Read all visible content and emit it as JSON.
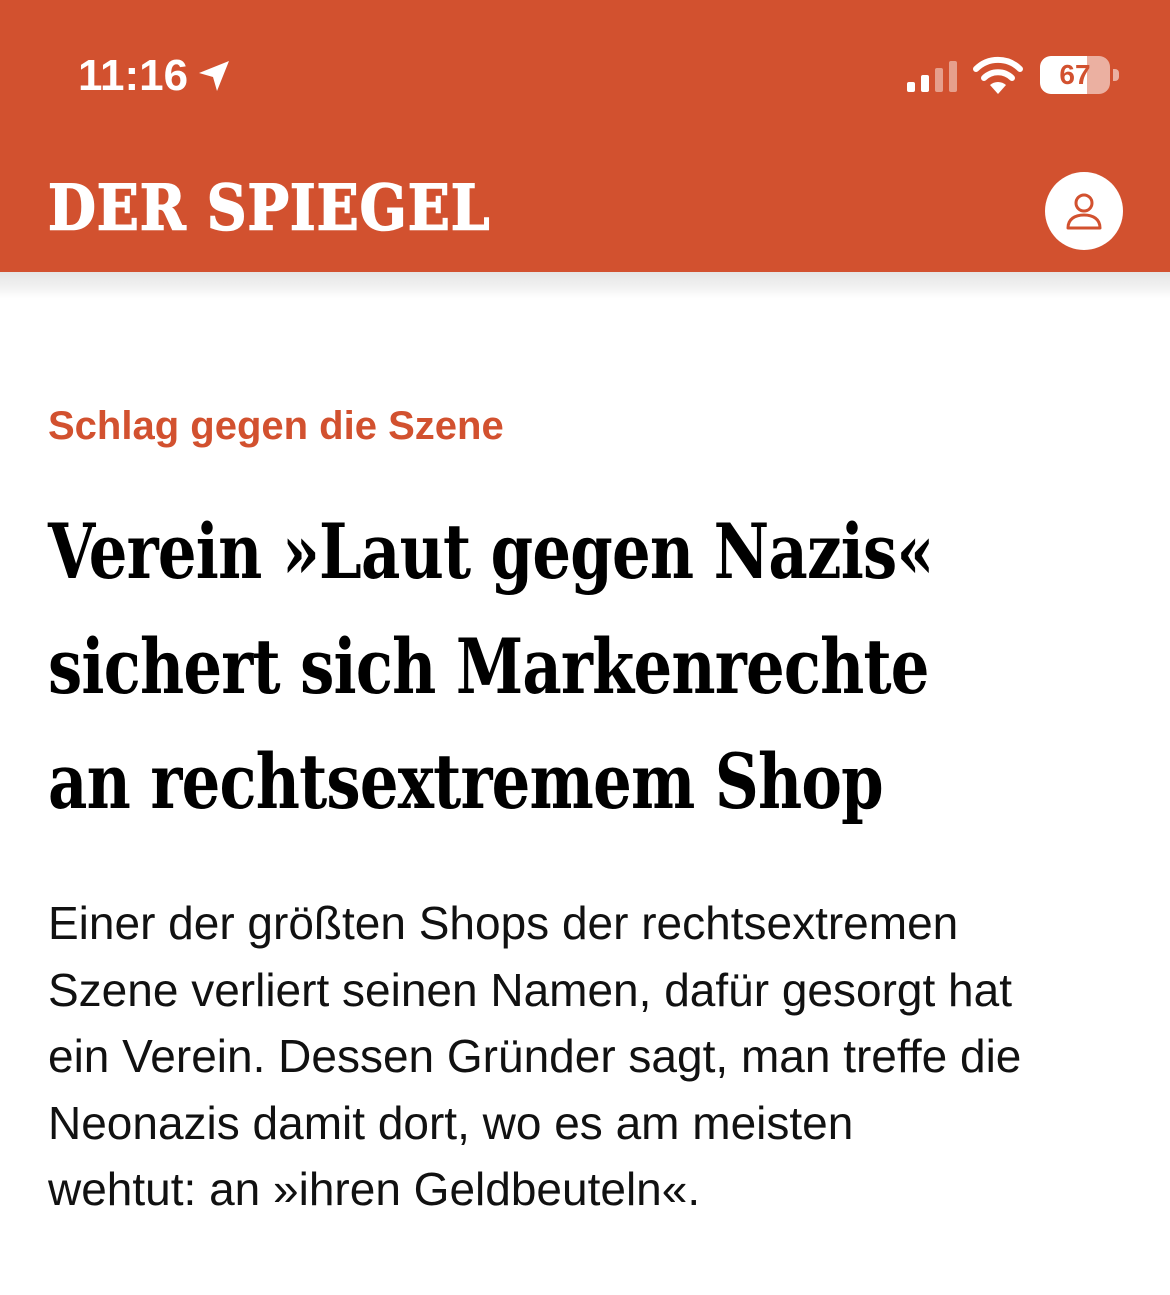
{
  "status_bar": {
    "time": "11:16",
    "battery_level": "67",
    "battery_fraction": 0.67,
    "icons": [
      "location-arrow-icon",
      "cellular-signal-icon",
      "wifi-icon",
      "battery-icon"
    ]
  },
  "header": {
    "brand": "DER SPIEGEL",
    "account_icon": "user-icon"
  },
  "article": {
    "kicker": "Schlag gegen die Szene",
    "headline_lines": [
      "Verein »Laut gegen Nazis«",
      "sichert sich Markenrechte",
      "an rechtsextremem Shop"
    ],
    "teaser_lines": [
      "Einer der größten Shops der rechtsextremen",
      "Szene verliert seinen Namen, dafür gesorgt hat",
      "ein Verein. Dessen Gründer sagt, man treffe die",
      "Neonazis damit dort, wo es am meisten",
      "wehtut: an »ihren Geldbeuteln«."
    ]
  },
  "colors": {
    "brand_red": "#d2512f",
    "text": "#000000",
    "background": "#ffffff"
  }
}
